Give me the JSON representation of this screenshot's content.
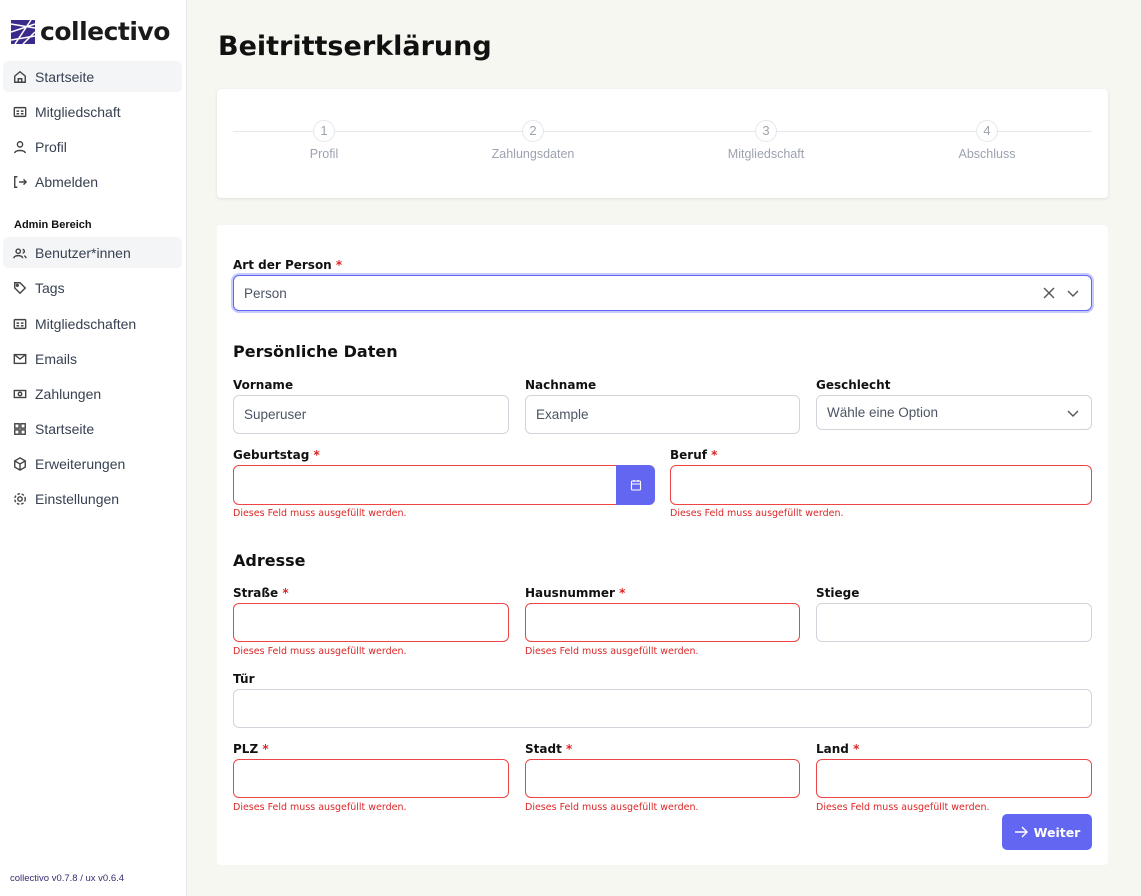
{
  "app": {
    "name": "collectivo",
    "version": "collectivo v0.7.8 / ux v0.6.4"
  },
  "sidebar": {
    "items": [
      {
        "label": "Startseite",
        "icon": "home-icon"
      },
      {
        "label": "Mitgliedschaft",
        "icon": "id-card-icon"
      },
      {
        "label": "Profil",
        "icon": "user-icon"
      },
      {
        "label": "Abmelden",
        "icon": "logout-icon"
      }
    ],
    "admin_heading": "Admin Bereich",
    "admin_items": [
      {
        "label": "Benutzer*innen"
      },
      {
        "label": "Tags"
      },
      {
        "label": "Mitgliedschaften"
      },
      {
        "label": "Emails"
      },
      {
        "label": "Zahlungen"
      },
      {
        "label": "Startseite"
      },
      {
        "label": "Erweiterungen"
      },
      {
        "label": "Einstellungen"
      }
    ]
  },
  "page": {
    "title": "Beitrittserklärung"
  },
  "stepper": [
    {
      "num": "1",
      "label": "Profil"
    },
    {
      "num": "2",
      "label": "Zahlungsdaten"
    },
    {
      "num": "3",
      "label": "Mitgliedschaft"
    },
    {
      "num": "4",
      "label": "Abschluss"
    }
  ],
  "form": {
    "art_label": "Art der Person",
    "art_value": "Person",
    "req": "*",
    "section_personal": "Persönliche Daten",
    "vorname_label": "Vorname",
    "vorname_value": "Superuser",
    "nachname_label": "Nachname",
    "nachname_value": "Example",
    "geschlecht_label": "Geschlecht",
    "geschlecht_placeholder": "Wähle eine Option",
    "geburtstag_label": "Geburtstag",
    "beruf_label": "Beruf",
    "section_address": "Adresse",
    "strasse_label": "Straße",
    "hausnummer_label": "Hausnummer",
    "stiege_label": "Stiege",
    "tuer_label": "Tür",
    "plz_label": "PLZ",
    "stadt_label": "Stadt",
    "land_label": "Land",
    "error": "Dieses Feld muss ausgefüllt werden.",
    "next_label": "Weiter"
  }
}
